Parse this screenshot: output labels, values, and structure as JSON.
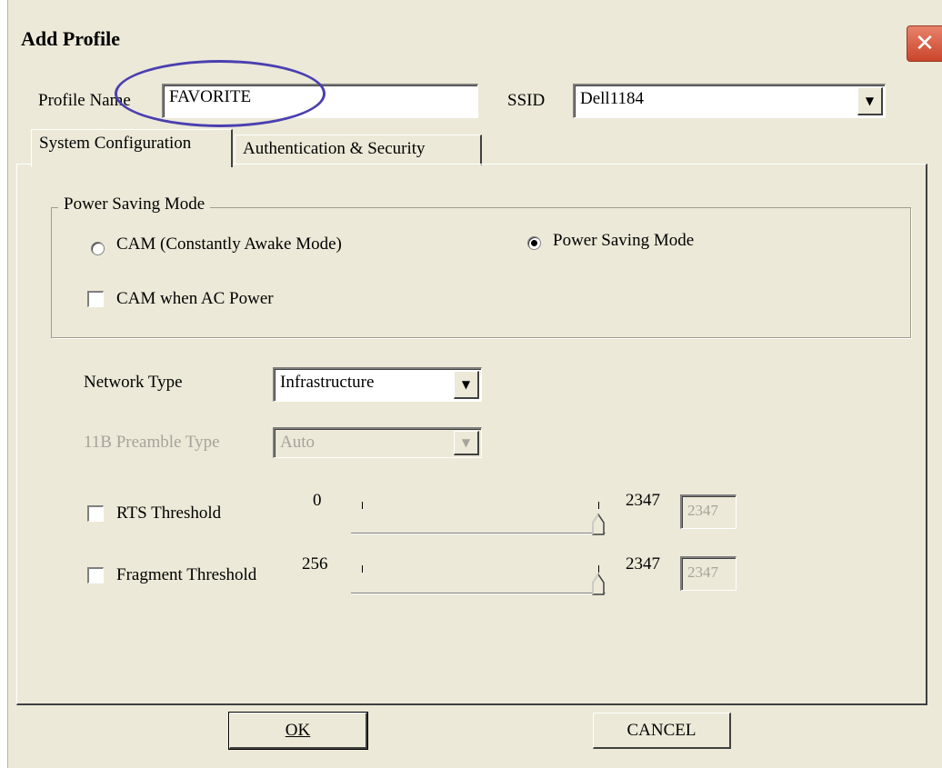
{
  "window": {
    "title": "Add Profile",
    "close_glyph": "✕"
  },
  "profile": {
    "name_label": "Profile Name",
    "name_value": "FAVORITE"
  },
  "ssid": {
    "label": "SSID",
    "value": "Dell1184"
  },
  "tabs": [
    {
      "label": "System Configuration",
      "active": true
    },
    {
      "label": "Authentication & Security",
      "active": false
    }
  ],
  "power_saving": {
    "group_label": "Power Saving Mode",
    "cam_label": "CAM (Constantly Awake Mode)",
    "psm_label": "Power Saving Mode",
    "selected": "Power Saving Mode",
    "cam_ac_label": "CAM when AC Power"
  },
  "network_type": {
    "label": "Network Type",
    "value": "Infrastructure"
  },
  "preamble": {
    "label": "11B Preamble Type",
    "value": "Auto"
  },
  "rts": {
    "label": "RTS Threshold",
    "min": "0",
    "max": "2347",
    "value": "2347",
    "fraction": 1.0
  },
  "fragment": {
    "label": "Fragment Threshold",
    "min": "256",
    "max": "2347",
    "value": "2347",
    "fraction": 1.0
  },
  "buttons": {
    "ok": "OK",
    "cancel": "CANCEL"
  },
  "icons": {
    "combo_arrow": "▼"
  }
}
